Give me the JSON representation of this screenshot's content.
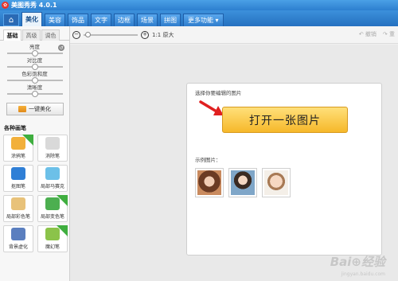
{
  "app": {
    "title": "美图秀秀 4.0.1",
    "logo_glyph": "✿"
  },
  "nav": {
    "home_icon": "⌂",
    "tabs": [
      {
        "label": "美化",
        "active": true
      },
      {
        "label": "美容",
        "active": false
      },
      {
        "label": "饰品",
        "active": false
      },
      {
        "label": "文字",
        "active": false
      },
      {
        "label": "边框",
        "active": false
      },
      {
        "label": "场景",
        "active": false
      },
      {
        "label": "拼图",
        "active": false
      }
    ],
    "more_label": "更多功能 ▾"
  },
  "toolbar": {
    "zoom_out": "−",
    "zoom_in": "+",
    "actual_size_label": "1:1 原大",
    "undo_label": "↶ 撤销",
    "redo_label": "↷ 重"
  },
  "left_panel": {
    "subtabs": [
      {
        "label": "基础",
        "active": true
      },
      {
        "label": "高级",
        "active": false
      },
      {
        "label": "调色",
        "active": false
      }
    ],
    "sliders": [
      {
        "label": "亮度",
        "value": 0.5
      },
      {
        "label": "对比度",
        "value": 0.5
      },
      {
        "label": "色彩饱和度",
        "value": 0.5
      },
      {
        "label": "清晰度",
        "value": 0.5
      }
    ],
    "beautify_label": "一键美化",
    "brushes_title": "各种画笔",
    "tools": [
      {
        "label": "涂鸦笔",
        "icon": "pencil-icon",
        "color": "#f2b03b",
        "new": true
      },
      {
        "label": "消除笔",
        "icon": "eraser-icon",
        "color": "#d9d9d9",
        "new": false
      },
      {
        "label": "抠图笔",
        "icon": "cutout-brush-icon",
        "color": "#2f7fd6",
        "new": false
      },
      {
        "label": "局部马赛克",
        "icon": "mosaic-icon",
        "color": "#6cc0e8",
        "new": false
      },
      {
        "label": "局部彩色笔",
        "icon": "color-brush-icon",
        "color": "#e8c27a",
        "new": false
      },
      {
        "label": "局部变色笔",
        "icon": "recolor-brush-icon",
        "color": "#4caf50",
        "new": true
      },
      {
        "label": "背景虚化",
        "icon": "blur-background-icon",
        "color": "#5b7fbf",
        "new": false
      },
      {
        "label": "魔幻笔",
        "icon": "magic-pen-icon",
        "color": "#8bc34a",
        "new": true
      }
    ],
    "new_badge_text": "NEW"
  },
  "main": {
    "choose_label": "选择你要编辑的图片",
    "open_button_label": "打开一张图片",
    "samples_label": "示例图片：",
    "samples": [
      {
        "icon": "sample-photo-woman-icon",
        "color": "#c98a5e"
      },
      {
        "icon": "sample-photo-girl-icon",
        "color": "#7fa6c8"
      },
      {
        "icon": "sample-photo-baby-icon",
        "color": "#e8c6a8"
      }
    ]
  },
  "watermark": {
    "text": "Bai⊕经验",
    "sub": "jingyan.baidu.com"
  },
  "colors": {
    "accent": "#2d7fcf",
    "button": "#f6b82a",
    "arrow": "#e02020"
  }
}
